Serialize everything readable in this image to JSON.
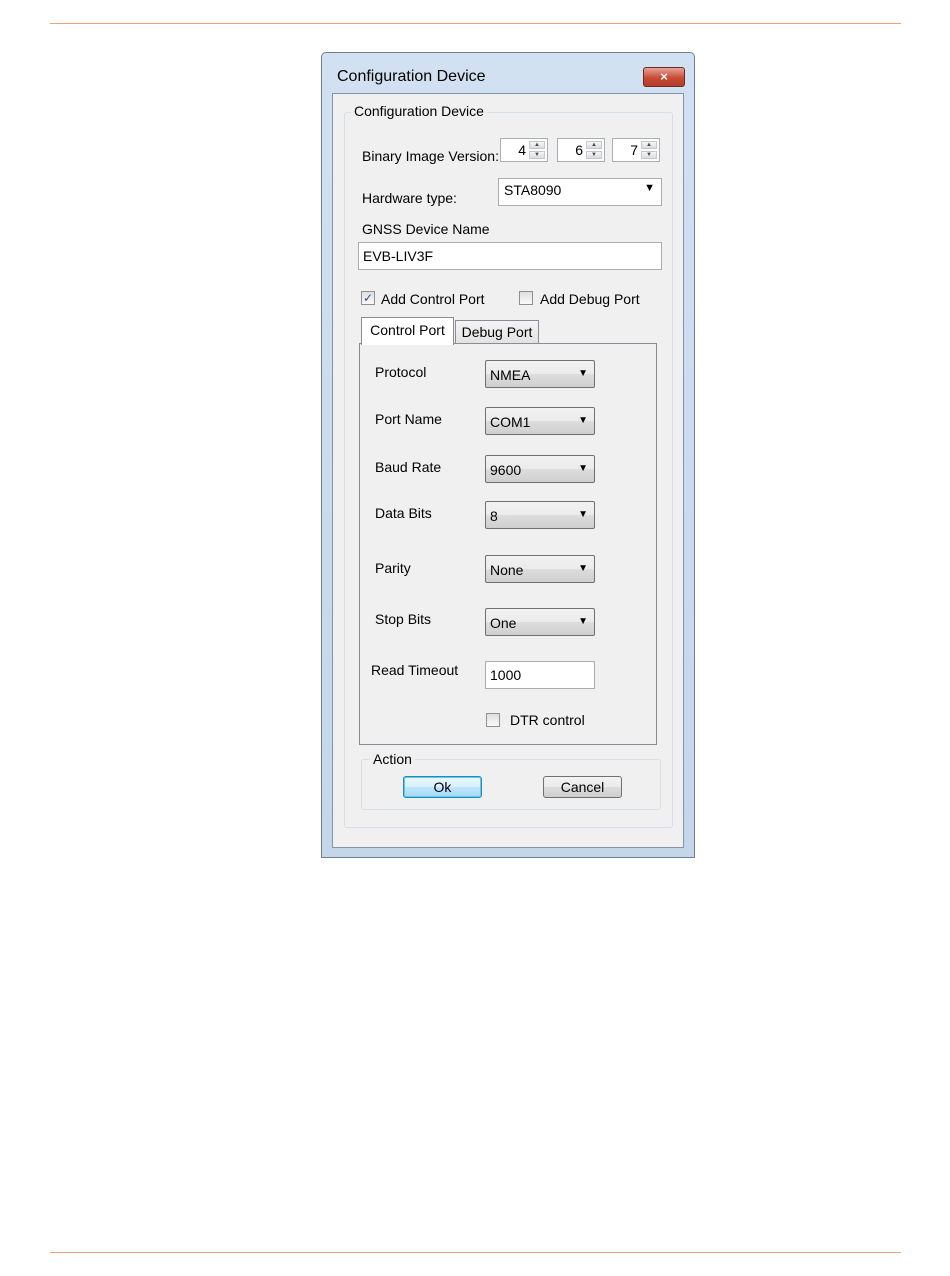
{
  "window": {
    "title": "Configuration Device",
    "close_glyph": "×"
  },
  "group_main": {
    "legend": "Configuration Device"
  },
  "binary_version": {
    "label": "Binary Image Version:",
    "major": "4",
    "minor": "6",
    "patch": "7"
  },
  "hardware": {
    "label": "Hardware type:",
    "value": "STA8090"
  },
  "device_name": {
    "label": "GNSS Device Name",
    "value": "EVB-LIV3F"
  },
  "options": {
    "add_control_port": {
      "label": "Add Control Port",
      "checked": true
    },
    "add_debug_port": {
      "label": "Add Debug Port",
      "checked": false
    }
  },
  "tabs": [
    {
      "label": "Control Port",
      "active": true
    },
    {
      "label": "Debug Port",
      "active": false
    }
  ],
  "control_port": {
    "protocol": {
      "label": "Protocol",
      "value": "NMEA"
    },
    "port_name": {
      "label": "Port Name",
      "value": "COM1"
    },
    "baud_rate": {
      "label": "Baud Rate",
      "value": "9600"
    },
    "data_bits": {
      "label": "Data Bits",
      "value": "8"
    },
    "parity": {
      "label": "Parity",
      "value": "None"
    },
    "stop_bits": {
      "label": "Stop Bits",
      "value": "One"
    },
    "read_timeout": {
      "label": "Read Timeout",
      "value": "1000"
    },
    "dtr_control": {
      "label": "DTR control",
      "checked": false
    }
  },
  "action": {
    "legend": "Action",
    "ok_label": "Ok",
    "cancel_label": "Cancel"
  },
  "glyphs": {
    "check": "✓",
    "arrow_down": "▼",
    "spin_up": "▲",
    "spin_down": "▼"
  }
}
